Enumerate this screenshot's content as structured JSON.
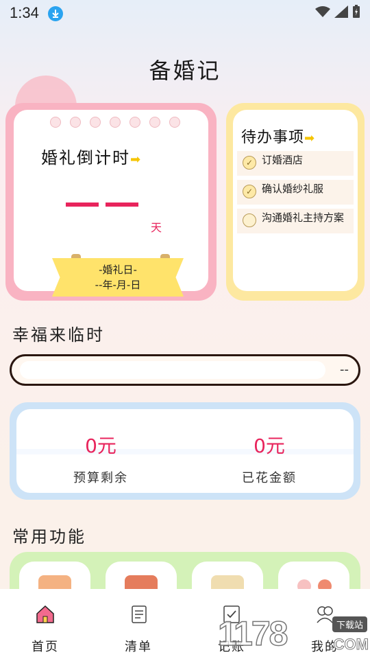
{
  "status_bar": {
    "time": "1:34"
  },
  "app": {
    "title": "备婚记"
  },
  "countdown": {
    "title": "婚礼倒计时",
    "arrow": "➡",
    "days_unit": "天",
    "wedding_day_label": "-婚礼日-",
    "wedding_date": "--年-月-日"
  },
  "todo": {
    "title": "待办事项",
    "arrow": "➡",
    "items": [
      {
        "text": "订婚酒店",
        "checked": true
      },
      {
        "text": "确认婚纱礼服",
        "checked": true
      },
      {
        "text": "沟通婚礼主持方案",
        "checked": false
      }
    ]
  },
  "happiness": {
    "title": "幸福来临时",
    "progress_text": "--",
    "progress_fraction": 0.0
  },
  "budget": {
    "remaining_value": "0元",
    "remaining_label": "预算剩余",
    "spent_value": "0元",
    "spent_label": "已花金额"
  },
  "functions": {
    "title": "常用功能"
  },
  "bottom_nav": [
    {
      "label": "首页",
      "icon": "home-icon",
      "active": true
    },
    {
      "label": "清单",
      "icon": "list-icon",
      "active": false
    },
    {
      "label": "记账",
      "icon": "ledger-icon",
      "active": false
    },
    {
      "label": "我的",
      "icon": "profile-icon",
      "active": false
    }
  ],
  "watermark": {
    "digits": "1178",
    "badge": "下载站",
    "suffix": ".COM"
  },
  "colors": {
    "accent": "#e8245c",
    "pink_card": "#f9b3c2",
    "yellow_card": "#fde8a0",
    "blue_card": "#cde3f7",
    "green_card": "#d4f2b8"
  }
}
